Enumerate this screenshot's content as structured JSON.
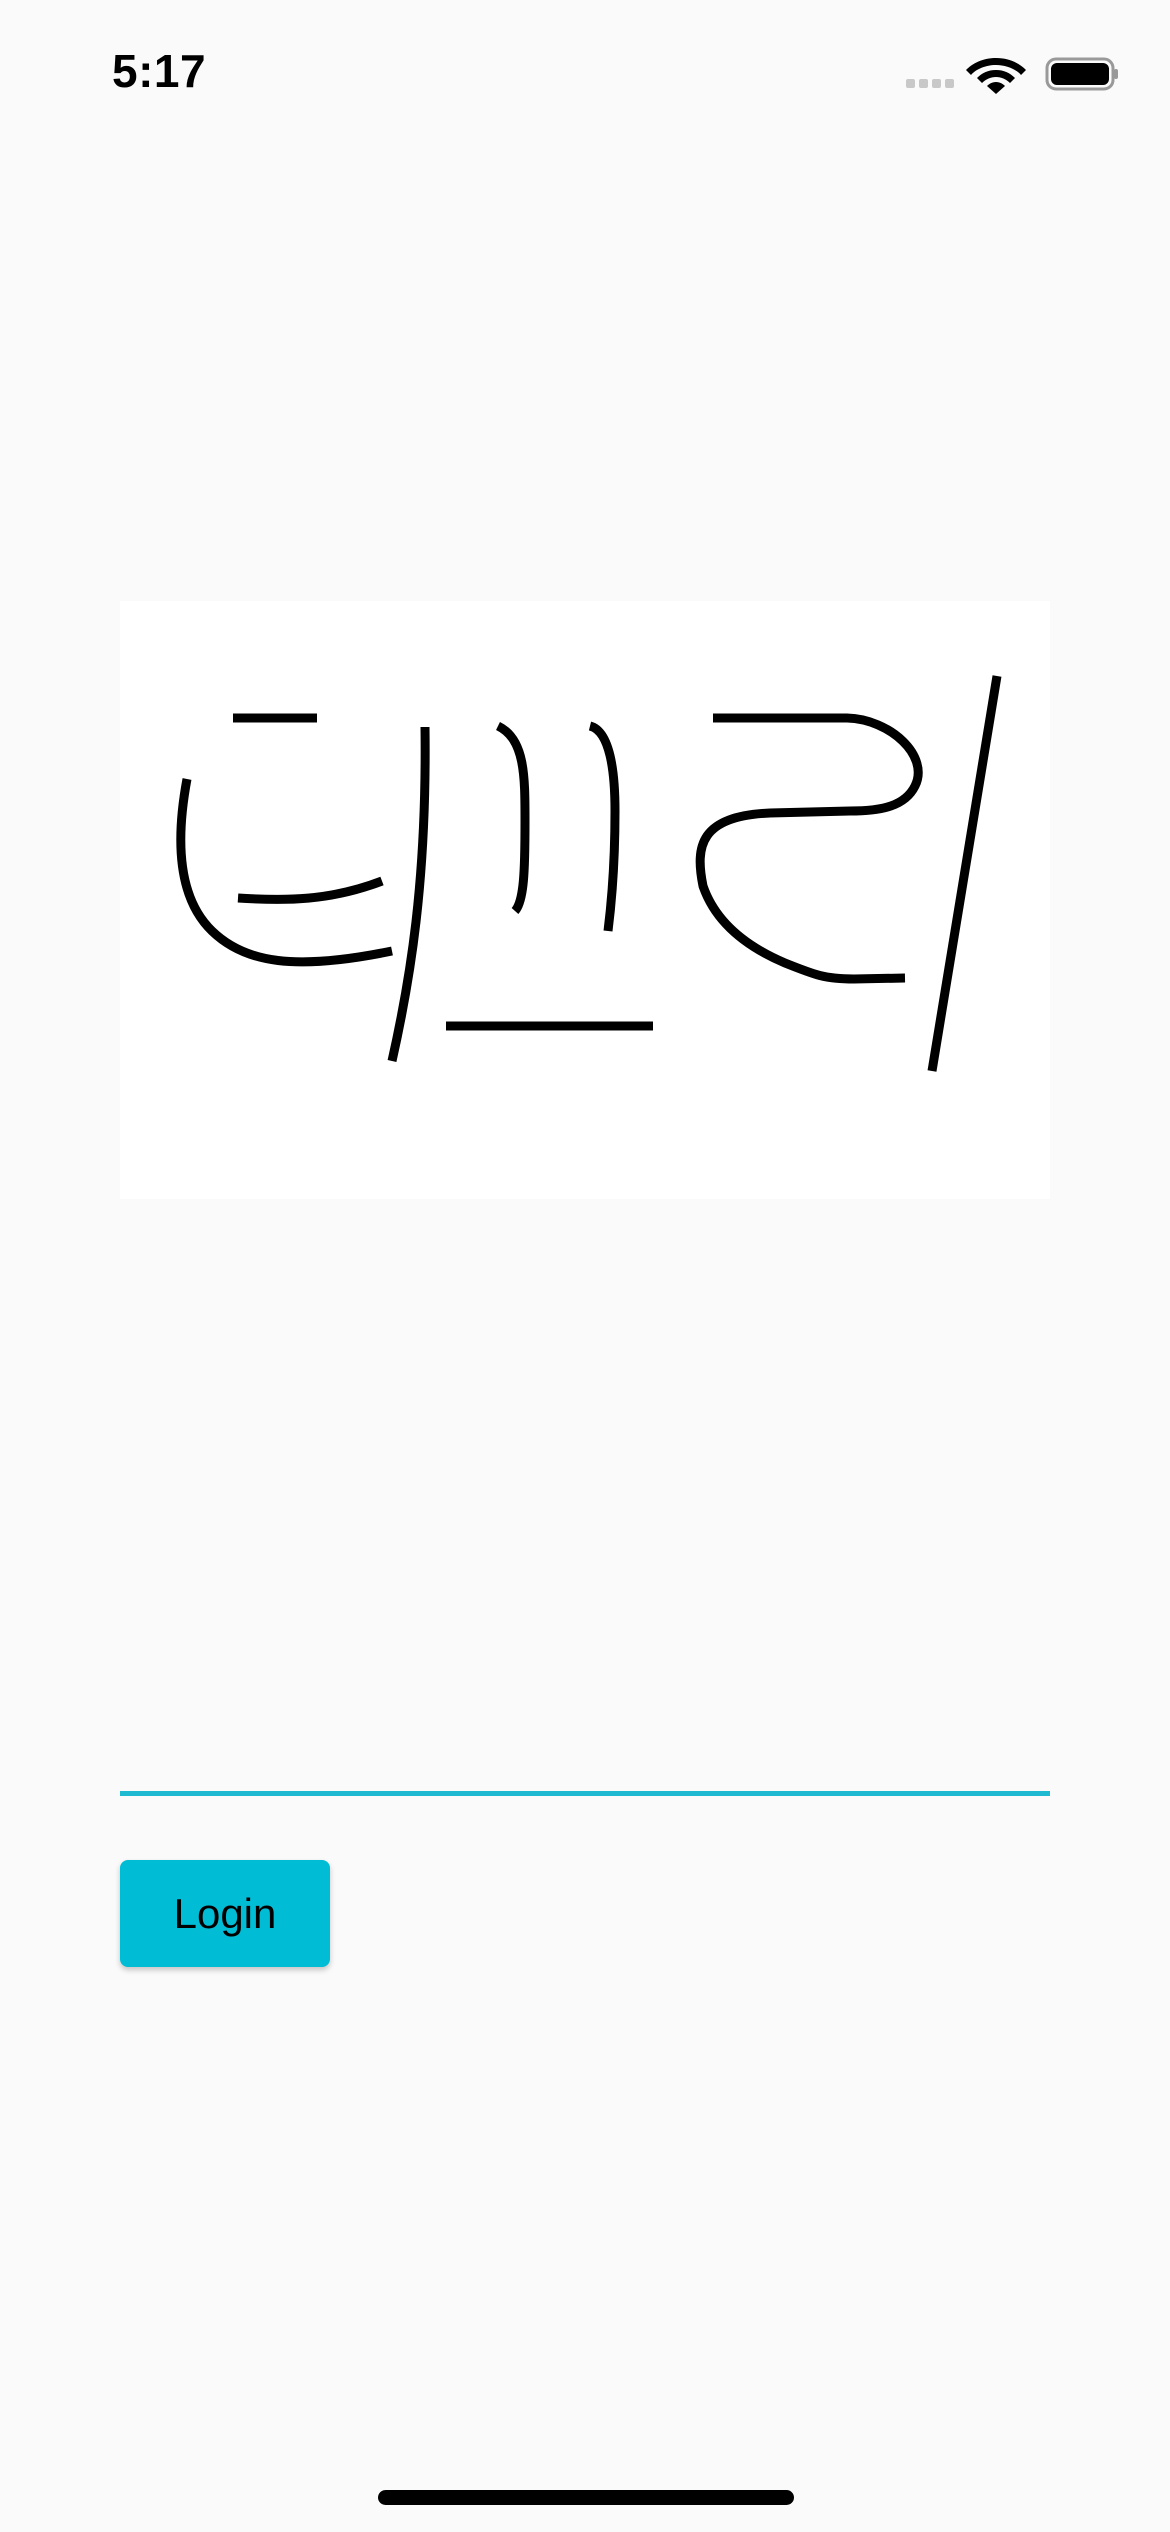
{
  "status_bar": {
    "time": "5:17",
    "icons": [
      "cellular-signal-icon",
      "wifi-icon",
      "battery-icon"
    ]
  },
  "captcha": {
    "lettering": "테끄리",
    "background_color": "#ffffff"
  },
  "answer_field": {
    "value": "",
    "placeholder": "",
    "underline_color": "#1fbad1"
  },
  "login_button": {
    "label": "Login",
    "color": "#00bcd4"
  },
  "colors": {
    "page_background": "#fafafa"
  }
}
